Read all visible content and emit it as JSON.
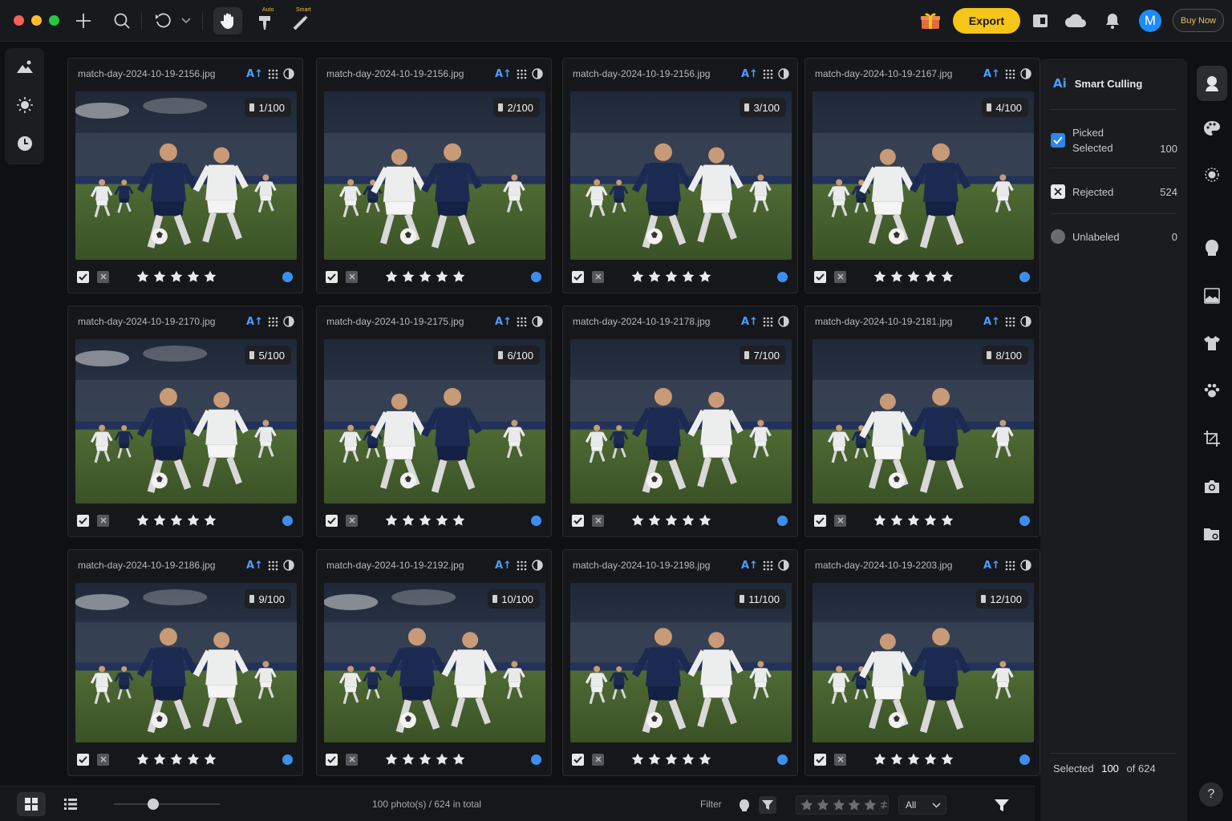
{
  "titlebar": {
    "auto_label": "Auto",
    "smart_label": "Smart",
    "export_label": "Export",
    "avatar_letter": "M",
    "buy_label": "Buy Now",
    "accent_color": "#f5c518"
  },
  "cards": [
    {
      "filename": "match-day-2024-10-19-2156.jpg",
      "counter": "1/100",
      "picked": true,
      "stars": 5,
      "color_label": "#3d8ef0"
    },
    {
      "filename": "match-day-2024-10-19-2156.jpg",
      "counter": "2/100",
      "picked": true,
      "stars": 5,
      "color_label": "#3d8ef0"
    },
    {
      "filename": "match-day-2024-10-19-2156.jpg",
      "counter": "3/100",
      "picked": true,
      "stars": 5,
      "color_label": "#3d8ef0"
    },
    {
      "filename": "match-day-2024-10-19-2167.jpg",
      "counter": "4/100",
      "picked": true,
      "stars": 5,
      "color_label": "#3d8ef0"
    },
    {
      "filename": "match-day-2024-10-19-2170.jpg",
      "counter": "5/100",
      "picked": true,
      "stars": 5,
      "color_label": "#3d8ef0"
    },
    {
      "filename": "match-day-2024-10-19-2175.jpg",
      "counter": "6/100",
      "picked": true,
      "stars": 5,
      "color_label": "#3d8ef0"
    },
    {
      "filename": "match-day-2024-10-19-2178.jpg",
      "counter": "7/100",
      "picked": true,
      "stars": 5,
      "color_label": "#3d8ef0"
    },
    {
      "filename": "match-day-2024-10-19-2181.jpg",
      "counter": "8/100",
      "picked": true,
      "stars": 5,
      "color_label": "#3d8ef0"
    },
    {
      "filename": "match-day-2024-10-19-2186.jpg",
      "counter": "9/100",
      "picked": true,
      "stars": 5,
      "color_label": "#3d8ef0"
    },
    {
      "filename": "match-day-2024-10-19-2192.jpg",
      "counter": "10/100",
      "picked": true,
      "stars": 5,
      "color_label": "#3d8ef0"
    },
    {
      "filename": "match-day-2024-10-19-2198.jpg",
      "counter": "11/100",
      "picked": true,
      "stars": 5,
      "color_label": "#3d8ef0"
    },
    {
      "filename": "match-day-2024-10-19-2203.jpg",
      "counter": "12/100",
      "picked": true,
      "stars": 5,
      "color_label": "#3d8ef0"
    }
  ],
  "panel": {
    "ai_mark": "Ai",
    "title": "Smart Culling",
    "picked_label": "Picked",
    "selected_label": "Selected",
    "selected_value": "100",
    "rejected_label": "Rejected",
    "rejected_value": "524",
    "unlabeled_label": "Unlabeled",
    "unlabeled_value": "0",
    "footer_prefix": "Selected",
    "footer_selected": "100",
    "footer_total": "of 624"
  },
  "bottombar": {
    "count_text": "100 photo(s) / 624 in total",
    "filter_label": "Filter",
    "filter_value": "All",
    "thumb_size_fraction": 0.37
  },
  "help_label": "?"
}
